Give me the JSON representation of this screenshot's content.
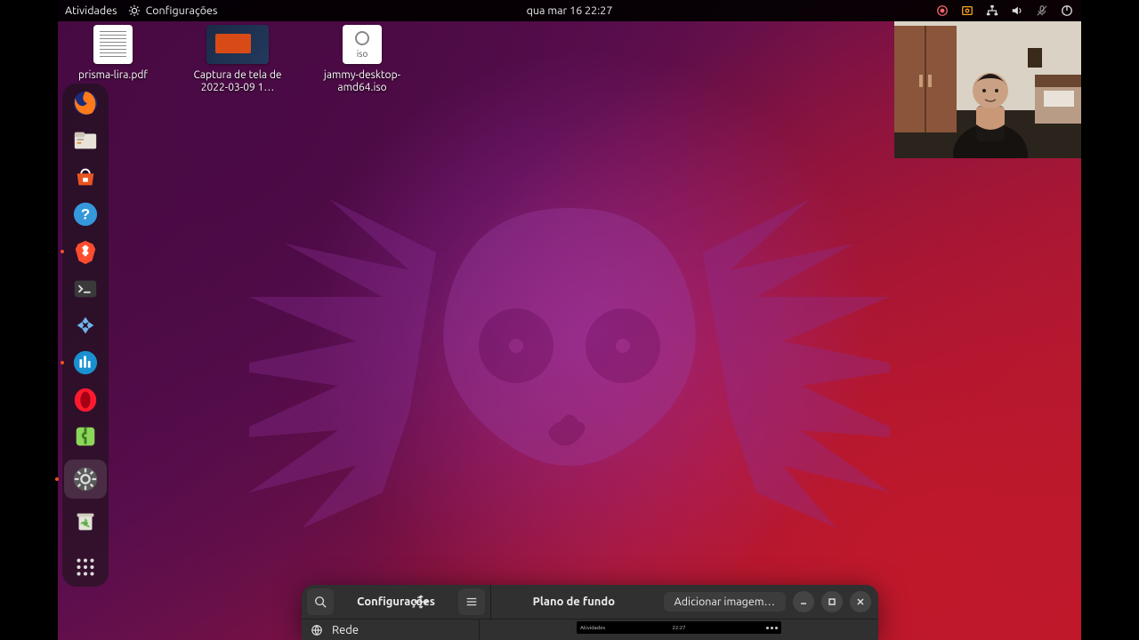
{
  "topbar": {
    "activities": "Atividades",
    "app_indicator": "Configurações",
    "clock": "qua mar 16  22:27"
  },
  "desktop_files": [
    {
      "name": "prisma-lira.pdf",
      "kind": "doc"
    },
    {
      "name": "Captura de tela de 2022-03-09 1…",
      "kind": "screenshot"
    },
    {
      "name": "jammy-desktop-amd64.iso",
      "kind": "iso"
    }
  ],
  "dock": {
    "items": [
      {
        "id": "firefox",
        "color": "#ff7a18"
      },
      {
        "id": "files",
        "color": "#e7e2da"
      },
      {
        "id": "software",
        "color": "#e95420"
      },
      {
        "id": "help",
        "color": "#3498db"
      },
      {
        "id": "brave",
        "color": "#ff4c2e"
      },
      {
        "id": "terminal",
        "color": "#3a3a3a"
      },
      {
        "id": "ppsspp",
        "color": "#2b2b2b"
      },
      {
        "id": "audio",
        "color": "#1990d0"
      },
      {
        "id": "opera",
        "color": "#ff1b2d"
      },
      {
        "id": "extensions",
        "color": "#6ab04c"
      },
      {
        "id": "settings",
        "color": "#4a4a4a"
      },
      {
        "id": "trash",
        "color": "#dcdcd0"
      }
    ]
  },
  "settings_window": {
    "sidebar_title": "Configurações",
    "header_title": "Plano de fundo",
    "add_image_label": "Adicionar imagem…",
    "sidebar_first_item": "Rede",
    "mini_preview": {
      "left": "Atividades",
      "center": "22:27"
    }
  }
}
